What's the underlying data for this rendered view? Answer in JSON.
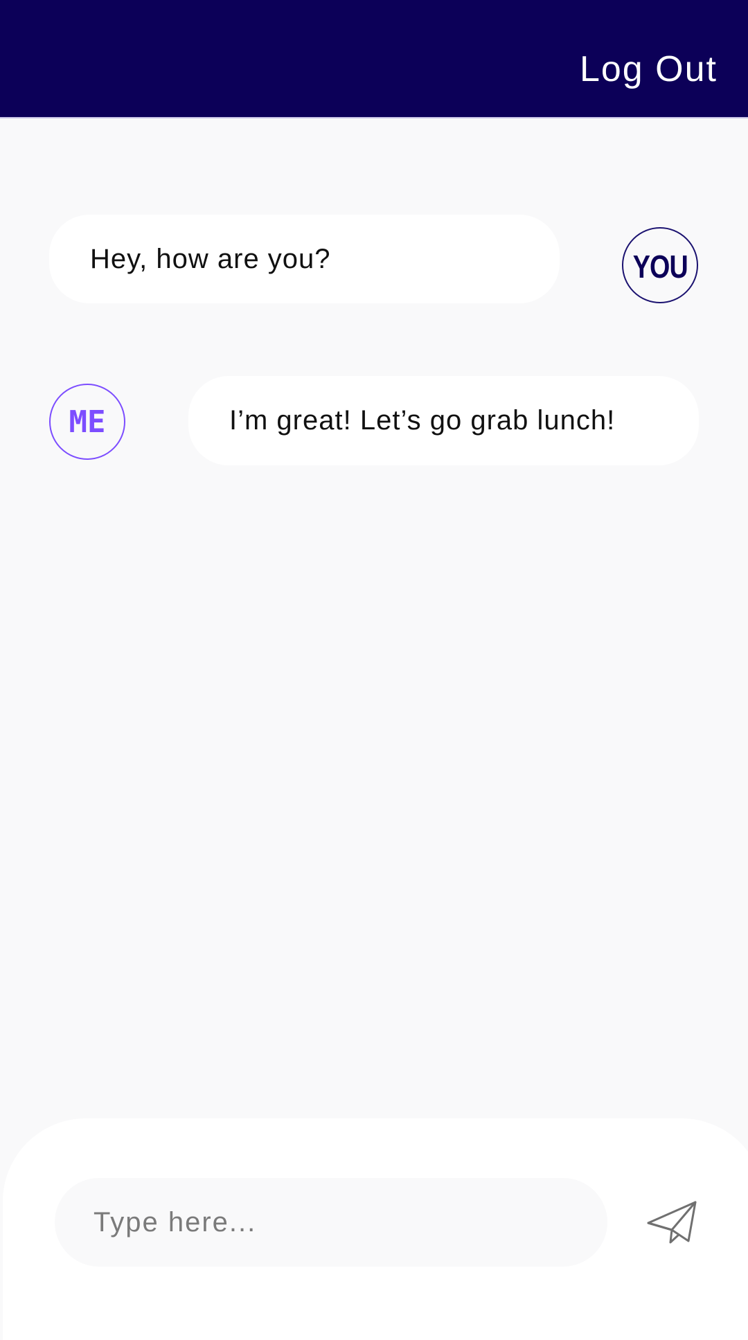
{
  "header": {
    "logout_label": "Log Out"
  },
  "messages": [
    {
      "sender": "YOU",
      "text": "Hey, how are you?"
    },
    {
      "sender": "ME",
      "text": "I’m great! Let’s go grab lunch!"
    }
  ],
  "composer": {
    "placeholder": "Type here...",
    "value": "",
    "send_icon": "paper-plane-icon"
  },
  "colors": {
    "app_bar": "#0c0058",
    "you_accent": "#0c0058",
    "me_accent": "#7c4dff",
    "background": "#f9f9fa"
  }
}
